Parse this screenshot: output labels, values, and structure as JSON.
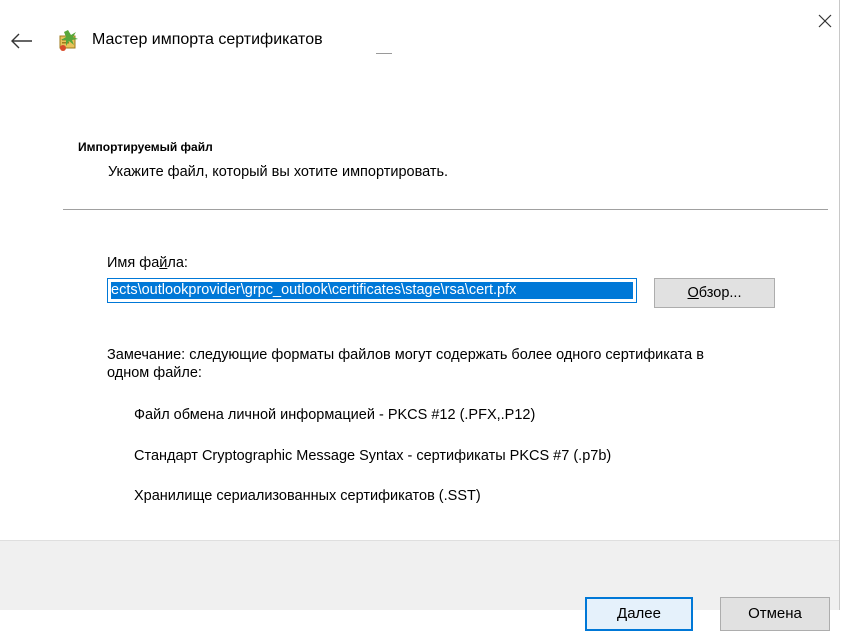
{
  "window": {
    "title": "Мастер импорта сертификатов"
  },
  "page": {
    "heading": "Импортируемый файл",
    "subheading": "Укажите файл, который вы хотите импортировать."
  },
  "file": {
    "label_before": "Имя фа",
    "label_accel": "й",
    "label_after": "ла:",
    "value": "ects\\outlookprovider\\grpc_outlook\\certificates\\stage\\rsa\\cert.pfx",
    "browse_accel": "О",
    "browse_rest": "бзор..."
  },
  "note": {
    "text": "Замечание: следующие форматы файлов могут содержать более одного сертификата в одном файле:",
    "formats": [
      "Файл обмена личной информацией - PKCS #12 (.PFX,.P12)",
      "Стандарт Cryptographic Message Syntax - сертификаты PKCS #7 (.p7b)",
      "Хранилище сериализованных сертификатов (.SST)"
    ]
  },
  "footer": {
    "next_accel": "Д",
    "next_rest": "алее",
    "cancel": "Отмена"
  },
  "icons": {
    "back": "back-arrow-icon",
    "wizard": "certificate-wizard-icon",
    "close": "close-icon"
  },
  "colors": {
    "accent": "#0078d7",
    "footer_bg": "#f0f0f0",
    "button_bg": "#e1e1e1"
  }
}
